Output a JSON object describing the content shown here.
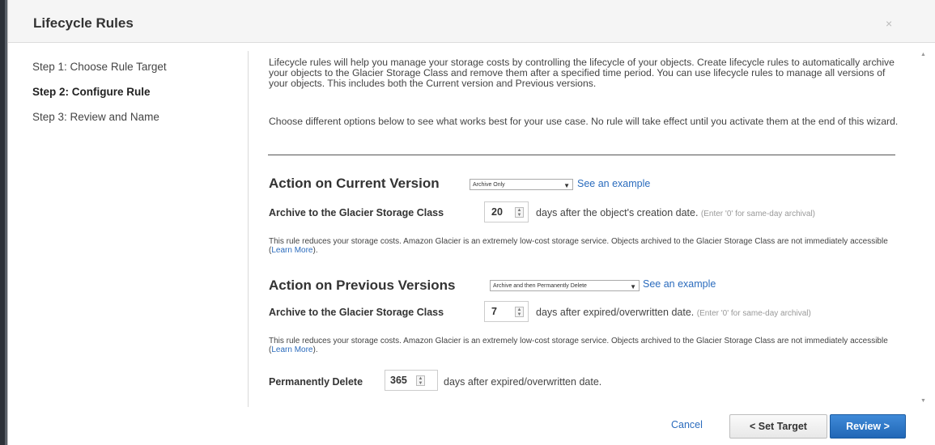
{
  "dialog": {
    "title": "Lifecycle Rules",
    "close_icon": "×"
  },
  "steps": [
    {
      "label": "Step 1: Choose Rule Target",
      "active": false
    },
    {
      "label": "Step 2: Configure Rule",
      "active": true
    },
    {
      "label": "Step 3: Review and Name",
      "active": false
    }
  ],
  "intro": {
    "paragraph1": "Lifecycle rules will help you manage your storage costs by controlling the lifecycle of your objects. Create lifecycle rules to automatically archive your objects to the Glacier Storage Class and remove them after a specified time period. You can use lifecycle rules to manage all versions of your objects. This includes both the Current version and Previous versions.",
    "paragraph2": "Choose different options below to see what works best for your use case. No rule will take effect until you activate them at the end of this wizard."
  },
  "current_version": {
    "heading": "Action on Current Version",
    "select_value": "Archive Only",
    "example_link": "See an example",
    "archive_label": "Archive to the Glacier Storage Class",
    "archive_days": "20",
    "after_text": "days after the object's creation date.",
    "hint": "(Enter '0' for same-day archival)",
    "note_prefix": "This rule reduces your storage costs. Amazon Glacier is an extremely low-cost storage service. Objects archived to the Glacier Storage Class are not immediately accessible (",
    "note_link": "Learn More",
    "note_suffix": ")."
  },
  "previous_versions": {
    "heading": "Action on Previous Versions",
    "select_value": "Archive and then Permanently Delete",
    "example_link": "See an example",
    "archive_label": "Archive to the Glacier Storage Class",
    "archive_days": "7",
    "after_text": "days after expired/overwritten date.",
    "hint": "(Enter '0' for same-day archival)",
    "note_prefix": "This rule reduces your storage costs. Amazon Glacier is an extremely low-cost storage service. Objects archived to the Glacier Storage Class are not immediately accessible (",
    "note_link": "Learn More",
    "note_suffix": ").",
    "delete_label": "Permanently Delete",
    "delete_days": "365",
    "delete_after_text": "days after expired/overwritten date."
  },
  "footer": {
    "cancel": "Cancel",
    "set_target": "< Set Target",
    "review": "Review >"
  },
  "icons": {
    "dropdown_arrow": "chevron-down-icon",
    "spinner": "stepper-arrows-icon",
    "close": "close-icon"
  },
  "colors": {
    "primary_button": "#2a6ebf",
    "link": "#2a6bbd"
  }
}
